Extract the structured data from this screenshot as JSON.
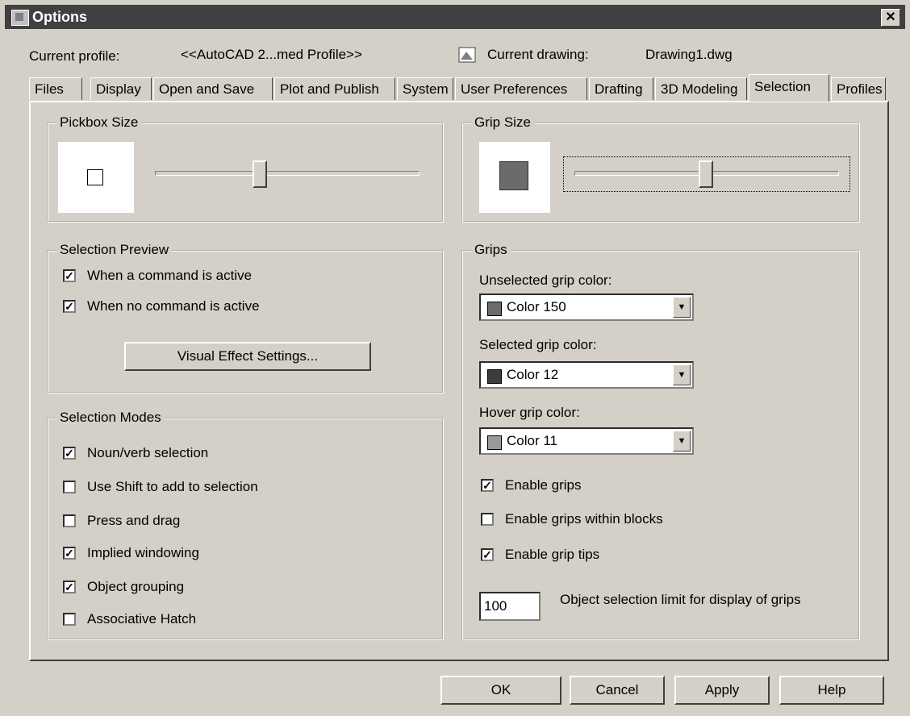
{
  "window": {
    "title": "Options",
    "close_label": "✕"
  },
  "header": {
    "profile_label": "Current profile:",
    "profile_value": "<<AutoCAD 2...med Profile>>",
    "drawing_label": "Current drawing:",
    "drawing_value": "Drawing1.dwg"
  },
  "tabs": [
    "Files",
    "Display",
    "Open and Save",
    "Plot and Publish",
    "System",
    "User Preferences",
    "Drafting",
    "3D Modeling",
    "Selection",
    "Profiles"
  ],
  "pickbox": {
    "legend": "Pickbox Size",
    "level": 0.4
  },
  "gripsize": {
    "legend": "Grip Size",
    "level": 0.5
  },
  "preview": {
    "legend": "Selection Preview",
    "when_active": {
      "label": "When a command is active",
      "checked": true
    },
    "when_none": {
      "label": "When no command is active",
      "checked": true
    },
    "visual_button": "Visual Effect Settings..."
  },
  "modes": {
    "legend": "Selection Modes",
    "items": [
      {
        "label": "Noun/verb selection",
        "checked": true
      },
      {
        "label": "Use Shift to add to selection",
        "checked": false
      },
      {
        "label": "Press and drag",
        "checked": false
      },
      {
        "label": "Implied windowing",
        "checked": true
      },
      {
        "label": "Object grouping",
        "checked": true
      },
      {
        "label": "Associative Hatch",
        "checked": false
      }
    ]
  },
  "grips": {
    "legend": "Grips",
    "unselected_label": "Unselected grip color:",
    "unselected_value": "Color 150",
    "unselected_color": "#6b6b6b",
    "selected_label": "Selected grip color:",
    "selected_value": "Color 12",
    "selected_color": "#3c3c3c",
    "hover_label": "Hover grip color:",
    "hover_value": "Color 11",
    "hover_color": "#9a9a9a",
    "enable": {
      "label": "Enable grips",
      "checked": true
    },
    "within_blocks": {
      "label": "Enable grips within blocks",
      "checked": false
    },
    "tips": {
      "label": "Enable grip tips",
      "checked": true
    },
    "limit_value": "100",
    "limit_label": "Object selection limit for display of grips"
  },
  "buttons": {
    "ok": "OK",
    "cancel": "Cancel",
    "apply": "Apply",
    "help": "Help"
  }
}
